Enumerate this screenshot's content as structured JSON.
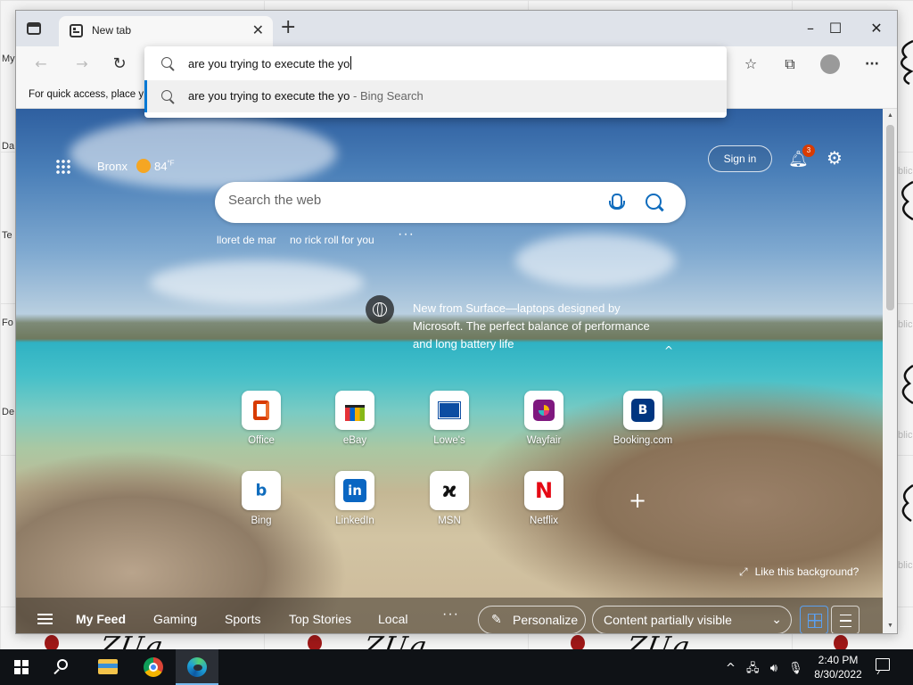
{
  "desktop": {
    "left_labels": [
      "My",
      "Da",
      "Te",
      "Fo",
      "De"
    ],
    "right_words": [
      "blic",
      "blic",
      "blic",
      "blic"
    ],
    "taskbar_art_text": "ZUg"
  },
  "browser": {
    "tab_title": "New tab",
    "address": {
      "typed_query": "are you trying to execute the yo",
      "suggestion_query": "are you trying to execute the yo",
      "suggestion_source": " - Bing Search"
    },
    "favorites_bar_text": "For quick access, place y"
  },
  "ntp": {
    "weather": {
      "location": "Bronx",
      "temp": "84",
      "unit": "°F"
    },
    "sign_in": "Sign in",
    "notification_count": "3",
    "search_placeholder": "Search the web",
    "trending": [
      "lloret de mar",
      "no rick roll for you"
    ],
    "promo_text": "New from Surface—laptops designed by Microsoft. The perfect balance of performance and long battery life",
    "quick_links": [
      {
        "label": "Office"
      },
      {
        "label": "eBay"
      },
      {
        "label": "Lowe's"
      },
      {
        "label": "Wayfair"
      },
      {
        "label": "Booking.com"
      },
      {
        "label": "Bing"
      },
      {
        "label": "LinkedIn"
      },
      {
        "label": "MSN"
      },
      {
        "label": "Netflix"
      }
    ],
    "like_background": "Like this background?",
    "feed_tabs": [
      "My Feed",
      "Gaming",
      "Sports",
      "Top Stories",
      "Local"
    ],
    "personalize": "Personalize",
    "content_visibility": "Content partially visible"
  },
  "taskbar": {
    "time": "2:40 PM",
    "date": "8/30/2022"
  },
  "colors": {
    "accent": "#0078d4",
    "notification_badge": "#d83b01"
  }
}
